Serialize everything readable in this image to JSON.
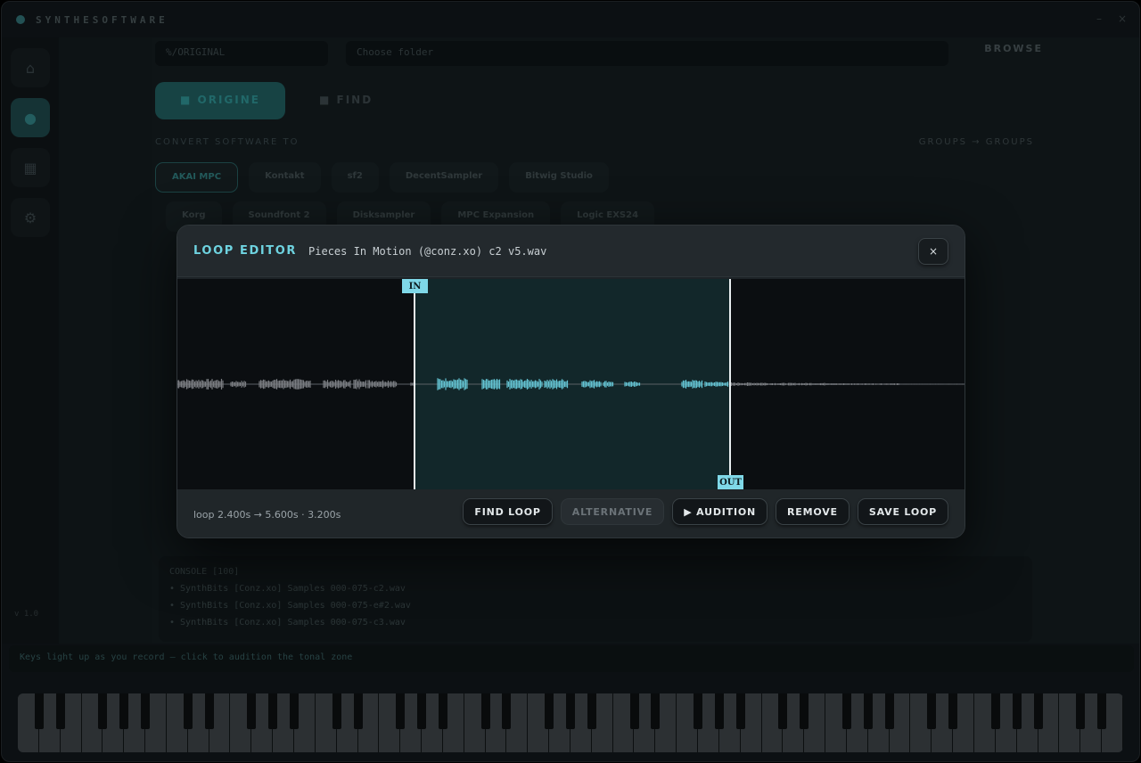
{
  "app": {
    "brand": "SYNTHESOFTWARE",
    "path_value": "%/ORIGINAL",
    "path_placeholder": "Choose folder",
    "browse_label": "BROWSE",
    "mode_on": "■ ORIGINE",
    "mode_off": "■ FIND",
    "convert_label": "CONVERT SOFTWARE TO",
    "group_label": "GROUPS → GROUPS",
    "formats_row1": [
      "AKAI MPC",
      "Kontakt",
      "sf2",
      "DecentSampler",
      "Bitwig Studio"
    ],
    "formats_row2": [
      "Korg",
      "Soundfont 2",
      "Disksampler",
      "MPC Expansion",
      "Logic EXS24"
    ],
    "console_lines": [
      "CONSOLE [100]",
      "• SynthBits [Conz.xo] Samples 000-075-c2.wav",
      "• SynthBits [Conz.xo] Samples 000-075-e#2.wav",
      "• SynthBits [Conz.xo] Samples 000-075-c3.wav"
    ],
    "status_text": "Keys light up as you record — click to audition the tonal zone",
    "version": "v 1.0"
  },
  "modal": {
    "title": "LOOP EDITOR",
    "filename": "Pieces In Motion (@conz.xo) c2 v5.wav",
    "close_label": "×",
    "in_label": "IN",
    "out_label": "OUT",
    "loop_info": "loop 2.400s → 5.600s · 3.200s",
    "loop_start_frac": 0.3,
    "loop_end_frac": 0.7,
    "buttons": {
      "find_loop": "FIND LOOP",
      "alternative": "ALTERNATIVE",
      "audition": "▶ AUDITION",
      "remove": "REMOVE",
      "save_loop": "SAVE LOOP"
    },
    "colors": {
      "accent": "#6ed3e0",
      "wave_active": "#63c3d2",
      "wave_inactive": "#7a7d82"
    }
  }
}
